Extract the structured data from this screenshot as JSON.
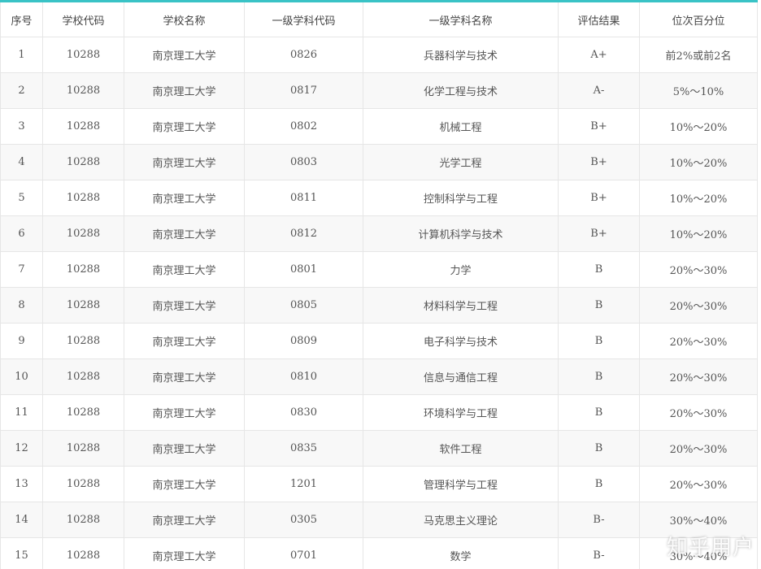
{
  "table": {
    "headers": [
      "序号",
      "学校代码",
      "学校名称",
      "一级学科代码",
      "一级学科名称",
      "评估结果",
      "位次百分位"
    ],
    "rows": [
      [
        "1",
        "10288",
        "南京理工大学",
        "0826",
        "兵器科学与技术",
        "A+",
        "前2%或前2名"
      ],
      [
        "2",
        "10288",
        "南京理工大学",
        "0817",
        "化学工程与技术",
        "A-",
        "5%～10%"
      ],
      [
        "3",
        "10288",
        "南京理工大学",
        "0802",
        "机械工程",
        "B+",
        "10%～20%"
      ],
      [
        "4",
        "10288",
        "南京理工大学",
        "0803",
        "光学工程",
        "B+",
        "10%～20%"
      ],
      [
        "5",
        "10288",
        "南京理工大学",
        "0811",
        "控制科学与工程",
        "B+",
        "10%～20%"
      ],
      [
        "6",
        "10288",
        "南京理工大学",
        "0812",
        "计算机科学与技术",
        "B+",
        "10%～20%"
      ],
      [
        "7",
        "10288",
        "南京理工大学",
        "0801",
        "力学",
        "B",
        "20%～30%"
      ],
      [
        "8",
        "10288",
        "南京理工大学",
        "0805",
        "材料科学与工程",
        "B",
        "20%～30%"
      ],
      [
        "9",
        "10288",
        "南京理工大学",
        "0809",
        "电子科学与技术",
        "B",
        "20%～30%"
      ],
      [
        "10",
        "10288",
        "南京理工大学",
        "0810",
        "信息与通信工程",
        "B",
        "20%～30%"
      ],
      [
        "11",
        "10288",
        "南京理工大学",
        "0830",
        "环境科学与工程",
        "B",
        "20%～30%"
      ],
      [
        "12",
        "10288",
        "南京理工大学",
        "0835",
        "软件工程",
        "B",
        "20%～30%"
      ],
      [
        "13",
        "10288",
        "南京理工大学",
        "1201",
        "管理科学与工程",
        "B",
        "20%～30%"
      ],
      [
        "14",
        "10288",
        "南京理工大学",
        "0305",
        "马克思主义理论",
        "B-",
        "30%～40%"
      ],
      [
        "15",
        "10288",
        "南京理工大学",
        "0701",
        "数学",
        "B-",
        "30%～40%"
      ]
    ]
  },
  "watermark": "知乎用户",
  "colors": {
    "header_accent": "#39c3c6",
    "stripe": "#f8f8f8",
    "border": "#e6e6e6"
  }
}
